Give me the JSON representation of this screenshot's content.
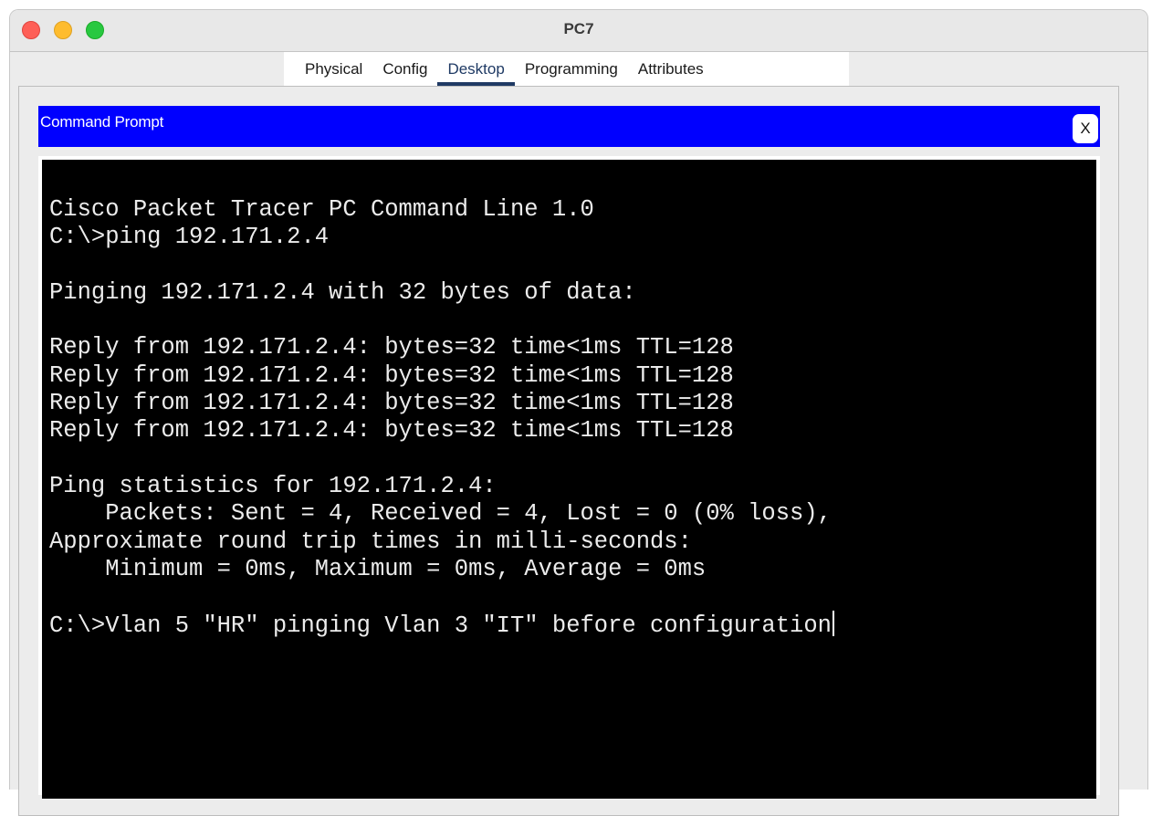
{
  "window": {
    "title": "PC7"
  },
  "tabs": [
    {
      "label": "Physical",
      "active": false
    },
    {
      "label": "Config",
      "active": false
    },
    {
      "label": "Desktop",
      "active": true
    },
    {
      "label": "Programming",
      "active": false
    },
    {
      "label": "Attributes",
      "active": false
    }
  ],
  "prompt": {
    "title": "Command Prompt",
    "close_label": "X"
  },
  "terminal": {
    "lines": [
      "Cisco Packet Tracer PC Command Line 1.0",
      "C:\\>ping 192.171.2.4",
      "",
      "Pinging 192.171.2.4 with 32 bytes of data:",
      "",
      "Reply from 192.171.2.4: bytes=32 time<1ms TTL=128",
      "Reply from 192.171.2.4: bytes=32 time<1ms TTL=128",
      "Reply from 192.171.2.4: bytes=32 time<1ms TTL=128",
      "Reply from 192.171.2.4: bytes=32 time<1ms TTL=128",
      "",
      "Ping statistics for 192.171.2.4:",
      "    Packets: Sent = 4, Received = 4, Lost = 0 (0% loss),",
      "Approximate round trip times in milli-seconds:",
      "    Minimum = 0ms, Maximum = 0ms, Average = 0ms",
      "",
      "C:\\>Vlan 5 \"HR\" pinging Vlan 3 \"IT\" before configuration"
    ]
  },
  "colors": {
    "prompt_bar": "#0000ff",
    "terminal_bg": "#000000",
    "terminal_text": "#ececec",
    "active_tab": "#1f3a64"
  }
}
